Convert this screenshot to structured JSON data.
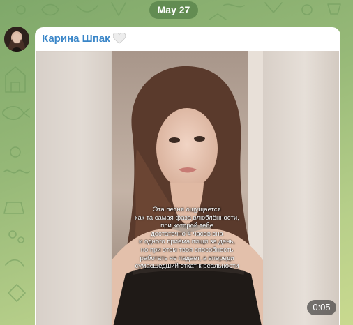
{
  "chat": {
    "date_label": "May 27",
    "colors": {
      "background": "#97b978",
      "sender_name": "#3a86c8",
      "date_pill": "#568048"
    }
  },
  "message": {
    "sender_name": "Карина Шпак",
    "sender_badge_icon": "white-heart-icon",
    "avatar_icon": "user-avatar",
    "video": {
      "caption_lines": [
        "Эта песня ощущается",
        "как та самая фаза влюблённости,",
        "при которой тебе",
        "достаточно 4 часов сна",
        "и одного приёма пищи за день,",
        "но при этом твоя способность",
        "работать не падает, а впереди",
        "сумасшедший откат к реальности"
      ],
      "duration": "0:05"
    }
  }
}
